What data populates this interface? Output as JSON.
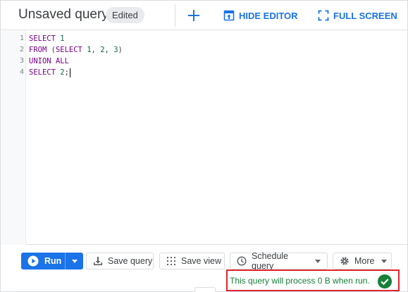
{
  "header": {
    "title": "Unsaved query",
    "badge": "Edited",
    "hide_editor_label": "HIDE EDITOR",
    "full_screen_label": "FULL SCREEN",
    "accent_color": "#1a73e8"
  },
  "editor": {
    "line_numbers": [
      "1",
      "2",
      "3",
      "4"
    ],
    "lines": [
      [
        {
          "t": "SELECT",
          "c": "kw"
        },
        {
          "t": " "
        },
        {
          "t": "1",
          "c": "num"
        }
      ],
      [
        {
          "t": "FROM",
          "c": "kw"
        },
        {
          "t": " ("
        },
        {
          "t": "SELECT",
          "c": "kw"
        },
        {
          "t": " "
        },
        {
          "t": "1",
          "c": "num"
        },
        {
          "t": ", "
        },
        {
          "t": "2",
          "c": "num"
        },
        {
          "t": ", "
        },
        {
          "t": "3",
          "c": "num"
        },
        {
          "t": ")"
        }
      ],
      [
        {
          "t": "UNION",
          "c": "kw"
        },
        {
          "t": " "
        },
        {
          "t": "ALL",
          "c": "kw"
        }
      ],
      [
        {
          "t": "SELECT",
          "c": "kw"
        },
        {
          "t": " "
        },
        {
          "t": "2",
          "c": "num"
        },
        {
          "t": ";"
        }
      ]
    ]
  },
  "toolbar": {
    "run_label": "Run",
    "save_query_label": "Save query",
    "save_view_label": "Save view",
    "schedule_query_label": "Schedule query",
    "more_label": "More"
  },
  "validation": {
    "message": "This query will process 0 B when run.",
    "status_color": "#188038",
    "icon": "check-circle-icon"
  }
}
